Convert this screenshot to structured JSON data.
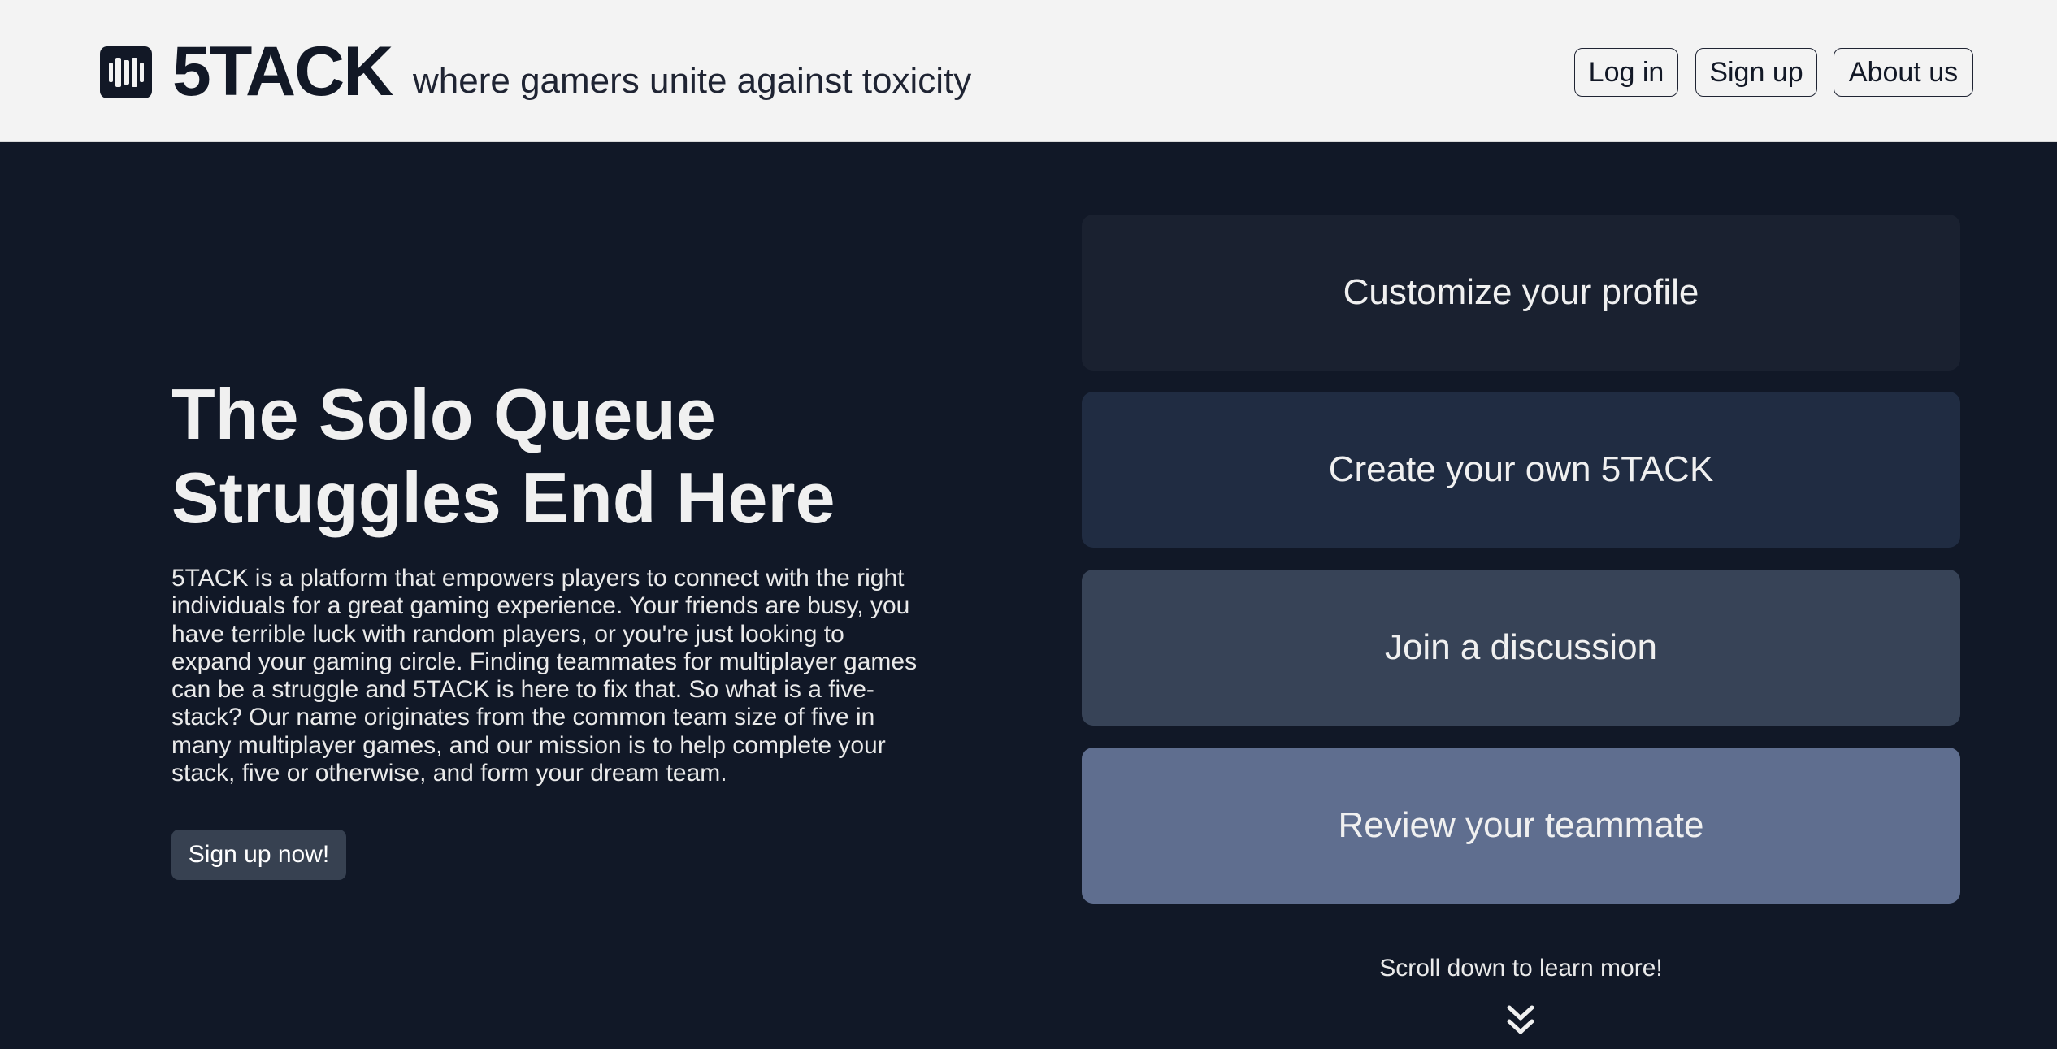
{
  "header": {
    "brand": "5TACK",
    "tagline": "where gamers unite against toxicity",
    "logo_icon": "equalizer-logo-icon",
    "nav": {
      "login": "Log in",
      "signup": "Sign up",
      "about": "About us"
    }
  },
  "hero": {
    "title_line1": "The Solo Queue",
    "title_line2": "Struggles End Here",
    "description": "5TACK is a platform that empowers players to connect with the right individuals for a great gaming experience. Your friends are busy, you have terrible luck with random players, or you're just looking to expand your gaming circle. Finding teammates for multiplayer games can be a struggle and 5TACK is here to fix that. So what is a five-stack? Our name originates from the common team size of five in many multiplayer games, and our mission is to help complete your stack, five or otherwise, and form your dream team.",
    "cta": "Sign up now!"
  },
  "features": [
    {
      "label": "Customize your profile",
      "color": "#1a2130"
    },
    {
      "label": "Create your own 5TACK",
      "color": "#202c42"
    },
    {
      "label": "Join a discussion",
      "color": "#374357"
    },
    {
      "label": "Review your teammate",
      "color": "#5f6e8f"
    }
  ],
  "scroll": {
    "text": "Scroll down to learn more!",
    "icon": "double-chevron-down-icon"
  },
  "colors": {
    "header_bg": "#f3f3f3",
    "page_bg": "#111827",
    "button_bg": "#374151"
  }
}
